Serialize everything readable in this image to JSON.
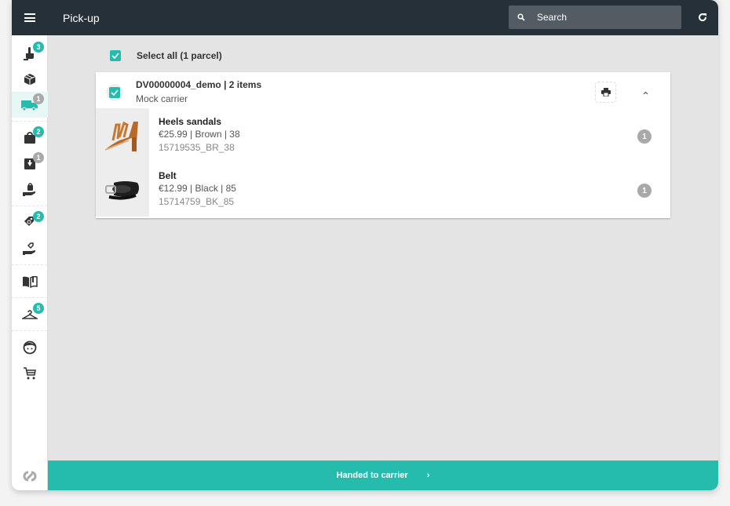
{
  "header": {
    "title": "Pick-up",
    "search_placeholder": "Search",
    "menu_icon": "hamburger-menu-icon",
    "search_icon": "search-icon",
    "refresh_icon": "refresh-icon"
  },
  "sidebar": {
    "items": [
      {
        "name": "pick",
        "icon": "hand-pointer-icon",
        "badge": "3",
        "badge_color": "#25bcae",
        "active": false
      },
      {
        "name": "pack",
        "icon": "box-icon",
        "badge": null,
        "active": false
      },
      {
        "name": "ship",
        "icon": "truck-icon",
        "badge": "1",
        "badge_color": "#a9a9a9",
        "active": true
      },
      {
        "name": "click-collect",
        "icon": "shopping-bag-icon",
        "badge": "2",
        "badge_color": "#25bcae",
        "active": false
      },
      {
        "name": "receive",
        "icon": "download-box-icon",
        "badge": "1",
        "badge_color": "#a9a9a9",
        "active": false
      },
      {
        "name": "handover-bag",
        "icon": "hand-bag-icon",
        "badge": null,
        "active": false
      },
      {
        "name": "returns",
        "icon": "tag-icon",
        "badge": "2",
        "badge_color": "#25bcae",
        "active": false
      },
      {
        "name": "handover-tag",
        "icon": "hand-tag-icon",
        "badge": null,
        "active": false
      },
      {
        "name": "catalog",
        "icon": "book-icon",
        "badge": null,
        "active": false
      },
      {
        "name": "hanger",
        "icon": "hanger-icon",
        "badge": "5",
        "badge_color": "#25bcae",
        "active": false
      },
      {
        "name": "customer",
        "icon": "customer-face-icon",
        "badge": null,
        "active": false
      },
      {
        "name": "cart",
        "icon": "cart-icon",
        "badge": null,
        "active": false
      }
    ],
    "logo_icon": "brand-logo-icon"
  },
  "main": {
    "select_all_label": "Select all (1 parcel)",
    "select_all_checked": true,
    "parcel": {
      "title": "DV00000004_demo | 2 items",
      "carrier": "Mock carrier",
      "checked": true,
      "items": [
        {
          "name": "Heels sandals",
          "meta": "€25.99 | Brown | 38",
          "sku": "15719535_BR_38",
          "qty": "1",
          "image": "heels-sandals-image"
        },
        {
          "name": "Belt",
          "meta": "€12.99 | Black | 85",
          "sku": "15714759_BK_85",
          "qty": "1",
          "image": "belt-image"
        }
      ]
    }
  },
  "footer": {
    "action_label": "Handed to carrier",
    "chevron": "›"
  },
  "colors": {
    "accent": "#25bcae",
    "topbar": "#253039",
    "search_bg": "#535c63",
    "badge_gray": "#a9a9a9"
  }
}
